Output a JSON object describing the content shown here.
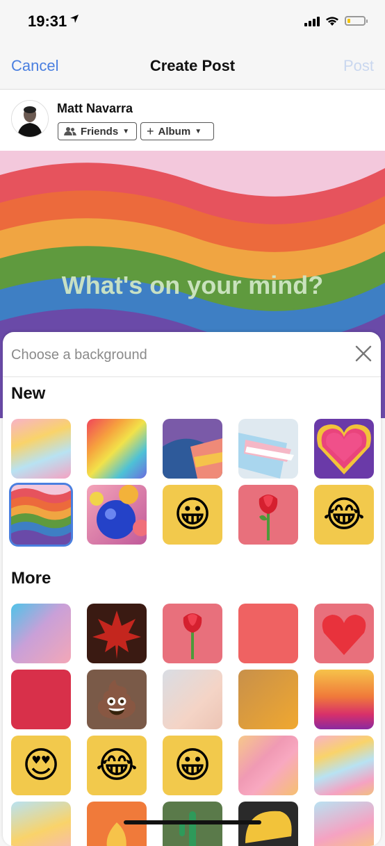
{
  "status_bar": {
    "time": "19:31"
  },
  "nav": {
    "cancel": "Cancel",
    "title": "Create Post",
    "post": "Post"
  },
  "author": {
    "name": "Matt Navarra",
    "audience": "Friends",
    "album": "Album"
  },
  "composer": {
    "placeholder": "What's on your mind?"
  },
  "sheet": {
    "title": "Choose a background",
    "sections": [
      {
        "title": "New"
      },
      {
        "title": "More"
      }
    ]
  },
  "colors": {
    "accent": "#4a7fe0",
    "post_disabled": "#c9d7ef"
  },
  "icons": [
    "location-arrow-icon",
    "signal-icon",
    "wifi-icon",
    "battery-icon",
    "friends-icon",
    "plus-icon",
    "caret-down-icon",
    "close-icon"
  ]
}
